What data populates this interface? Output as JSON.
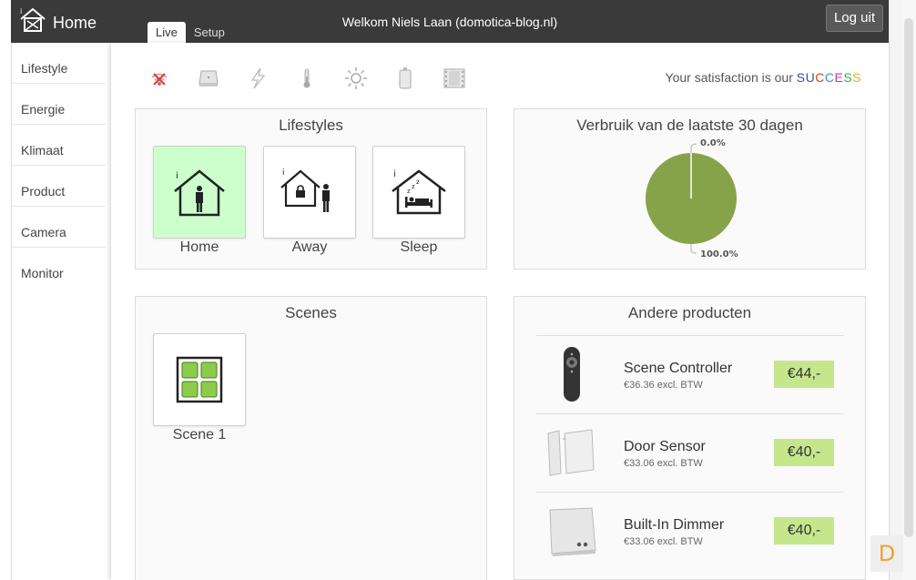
{
  "header": {
    "brand_label": "Home",
    "welcome": "Welkom Niels Laan (domotica-blog.nl)",
    "logout_label": "Log uit",
    "tabs": [
      {
        "label": "Live",
        "active": true
      },
      {
        "label": "Setup",
        "active": false
      }
    ]
  },
  "sidebar": {
    "items": [
      {
        "label": "Lifestyle"
      },
      {
        "label": "Energie"
      },
      {
        "label": "Klimaat"
      },
      {
        "label": "Product"
      },
      {
        "label": "Camera"
      },
      {
        "label": "Monitor"
      }
    ]
  },
  "status_icons": [
    "wifi-off-icon",
    "gateway-icon",
    "energy-icon",
    "thermometer-icon",
    "sun-icon",
    "battery-icon",
    "film-icon"
  ],
  "satisfaction": {
    "prefix": "Your satisfaction is our ",
    "word": "SUCCESS",
    "letter_colors": [
      "#3355aa",
      "#3355aa",
      "#e04020",
      "#3399cc",
      "#dd3388",
      "#33aa55",
      "#eeaa22"
    ]
  },
  "lifestyles": {
    "title": "Lifestyles",
    "tiles": [
      {
        "label": "Home",
        "active": true,
        "icon": "home-person-icon"
      },
      {
        "label": "Away",
        "active": false,
        "icon": "away-lock-icon"
      },
      {
        "label": "Sleep",
        "active": false,
        "icon": "sleep-icon"
      }
    ]
  },
  "verbruik": {
    "title": "Verbruik van de laatste 30 dagen",
    "chart_data": {
      "type": "pie",
      "slices": [
        {
          "value": 0.0,
          "label": "0.0%"
        },
        {
          "value": 100.0,
          "label": "100.0%"
        }
      ],
      "colors": [
        "#ffffff",
        "#86a34a"
      ]
    }
  },
  "scenes": {
    "title": "Scenes",
    "tiles": [
      {
        "label": "Scene 1",
        "icon": "scene-grid-icon"
      }
    ]
  },
  "products": {
    "title": "Andere producten",
    "items": [
      {
        "name": "Scene Controller",
        "sub": "€36.36 excl. BTW",
        "price": "€44,-",
        "icon": "remote-control-icon"
      },
      {
        "name": "Door Sensor",
        "sub": "€33.06 excl. BTW",
        "price": "€40,-",
        "icon": "door-sensor-icon"
      },
      {
        "name": "Built-In Dimmer",
        "sub": "€33.06 excl. BTW",
        "price": "€40,-",
        "icon": "dimmer-module-icon"
      }
    ]
  },
  "corner_badge": "D"
}
